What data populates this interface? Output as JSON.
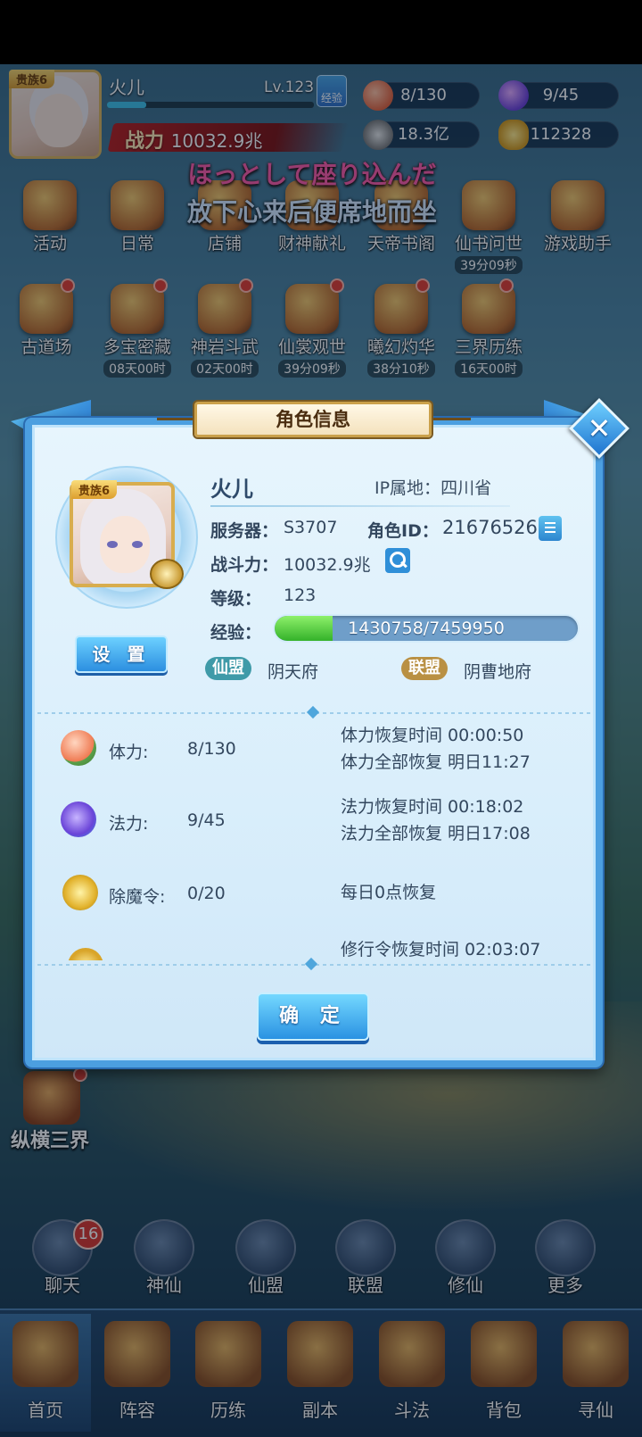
{
  "hud": {
    "noble": "贵族6",
    "name": "火儿",
    "level": "Lv.123",
    "exp_button": "经验",
    "exp_progress": 0.19,
    "power_label": "战力",
    "power_value": "10032.9兆",
    "stamina": "8/130",
    "mana": "9/45",
    "silver": "18.3亿",
    "gold": "112328"
  },
  "subtitles": {
    "jp": "ほっとして座り込んだ",
    "cn": "放下心来后便席地而坐"
  },
  "activities_row1": [
    {
      "label": "活动",
      "time": ""
    },
    {
      "label": "日常",
      "time": ""
    },
    {
      "label": "店铺",
      "time": ""
    },
    {
      "label": "财神献礼",
      "time": ""
    },
    {
      "label": "天帝书阁",
      "time": ""
    },
    {
      "label": "仙书问世",
      "time": "39分09秒"
    },
    {
      "label": "游戏助手",
      "time": ""
    }
  ],
  "activities_row2": [
    {
      "label": "古道场",
      "time": ""
    },
    {
      "label": "多宝密藏",
      "time": "08天00时"
    },
    {
      "label": "神岩斗武",
      "time": "02天00时"
    },
    {
      "label": "仙裳观世",
      "time": "39分09秒"
    },
    {
      "label": "曦幻灼华",
      "time": "38分10秒"
    },
    {
      "label": "三界历练",
      "time": "16天00时"
    }
  ],
  "side": {
    "label": "纵横三界"
  },
  "bottom_icons": [
    {
      "label": "聊天"
    },
    {
      "label": "神仙"
    },
    {
      "label": "仙盟"
    },
    {
      "label": "联盟"
    },
    {
      "label": "修仙"
    },
    {
      "label": "更多"
    }
  ],
  "chat_badge": "16",
  "tabs": [
    {
      "label": "首页"
    },
    {
      "label": "阵容"
    },
    {
      "label": "历练"
    },
    {
      "label": "副本"
    },
    {
      "label": "斗法"
    },
    {
      "label": "背包"
    },
    {
      "label": "寻仙"
    }
  ],
  "dialog": {
    "title": "角色信息",
    "close_icon": "close-icon",
    "noble": "贵族6",
    "settings_button": "设 置",
    "name": "火儿",
    "ip_label": "IP属地：",
    "ip_value": "四川省",
    "server_label": "服务器：",
    "server_value": "S3707",
    "role_id_label": "角色ID：",
    "role_id_value": "21676526",
    "combat_label": "战斗力：",
    "combat_value": "10032.9兆",
    "level_label": "等级：",
    "level_value": "123",
    "exp_label": "经验：",
    "exp_text": "1430758/7459950",
    "exp_progress": 0.19,
    "guild_tag": "仙盟",
    "guild_name": "阴天府",
    "alliance_tag": "联盟",
    "alliance_name": "阴曹地府",
    "stats": [
      {
        "icon": "peach-icon",
        "label": "体力:",
        "value": "8/130",
        "note1": "体力恢复时间 00:00:50",
        "note2": "体力全部恢复 明日11:27"
      },
      {
        "icon": "mana-flame-icon",
        "label": "法力:",
        "value": "9/45",
        "note1": "法力恢复时间 00:18:02",
        "note2": "法力全部恢复 明日17:08"
      },
      {
        "icon": "token-icon",
        "label": "除魔令:",
        "value": "0/20",
        "note1": "每日0点恢复",
        "note2": ""
      }
    ],
    "partial_note": "修行令恢复时间 02:03:07",
    "confirm_button": "确 定"
  },
  "colors": {
    "dialog_border": "#4c9fe0",
    "exp_fill": "#34b22a",
    "guild_tag": "#3f9aa8",
    "alliance_tag": "#b99043",
    "power_red": "#b51c1c"
  }
}
